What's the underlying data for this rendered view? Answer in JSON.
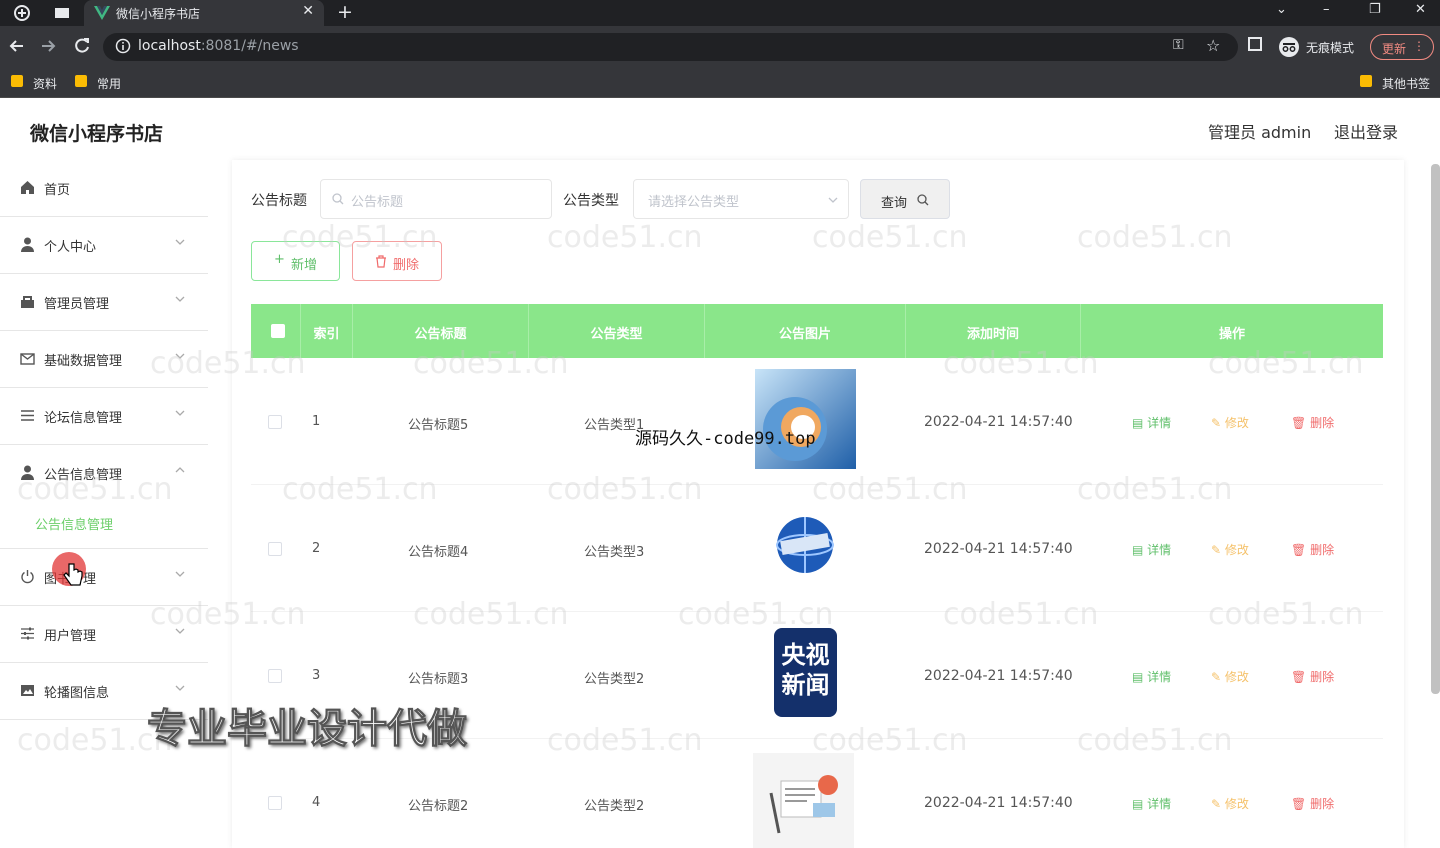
{
  "browser": {
    "tab_title": "微信小程序书店",
    "url_host": "localhost",
    "url_rest": ":8081/#/news",
    "incognito_label": "无痕模式",
    "update_label": "更新",
    "bookmarks": [
      "资料",
      "常用"
    ],
    "other_bookmarks": "其他书签"
  },
  "header": {
    "brand": "微信小程序书店",
    "admin": "管理员 admin",
    "logout": "退出登录"
  },
  "sidebar": {
    "items": [
      {
        "label": "首页",
        "icon": "home-icon"
      },
      {
        "label": "个人中心",
        "icon": "user-icon"
      },
      {
        "label": "管理员管理",
        "icon": "admin-icon"
      },
      {
        "label": "基础数据管理",
        "icon": "mail-icon"
      },
      {
        "label": "论坛信息管理",
        "icon": "list-icon"
      },
      {
        "label": "公告信息管理",
        "icon": "user-icon"
      },
      {
        "label": "图书管理",
        "icon": "power-icon"
      },
      {
        "label": "用户管理",
        "icon": "sliders-icon"
      },
      {
        "label": "轮播图信息",
        "icon": "picture-icon"
      }
    ],
    "active_sub": "公告信息管理"
  },
  "filters": {
    "title_label": "公告标题",
    "title_placeholder": "公告标题",
    "type_label": "公告类型",
    "type_placeholder": "请选择公告类型",
    "query_button": "查询"
  },
  "actions": {
    "add": "新增",
    "delete": "删除"
  },
  "table": {
    "columns": [
      "索引",
      "公告标题",
      "公告类型",
      "公告图片",
      "添加时间",
      "操作"
    ],
    "rows": [
      {
        "index": "1",
        "title": "公告标题5",
        "type": "公告类型1",
        "time": "2022-04-21 14:57:40",
        "image": "news-globe-blue"
      },
      {
        "index": "2",
        "title": "公告标题4",
        "type": "公告类型3",
        "time": "2022-04-21 14:57:40",
        "image": "news-globe"
      },
      {
        "index": "3",
        "title": "公告标题3",
        "type": "公告类型2",
        "time": "2022-04-21 14:57:40",
        "image": "cctv-news-logo"
      },
      {
        "index": "4",
        "title": "公告标题2",
        "type": "公告类型2",
        "time": "2022-04-21 14:57:40",
        "image": "newspaper-illustration"
      }
    ],
    "row_actions": {
      "detail": "详情",
      "edit": "修改",
      "remove": "删除"
    }
  },
  "cctv_logo_text": [
    "央视",
    "新闻"
  ],
  "watermark": "code51.cn",
  "overlay_text": "源码久久-code99.top",
  "promo_text": "专业毕业设计代做",
  "colors": {
    "header_green": "#8ae68a",
    "accent_green": "#5fbf6a",
    "danger": "#f06b6b",
    "warning": "#f5c26b"
  }
}
